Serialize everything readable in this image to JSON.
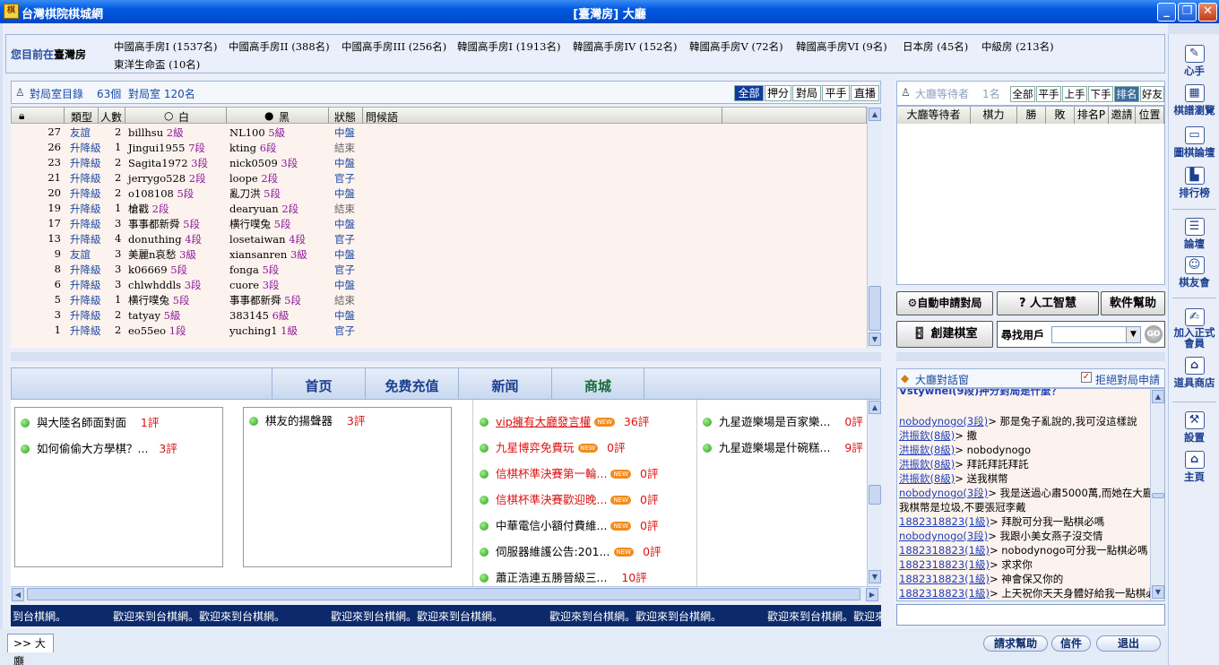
{
  "window": {
    "app_title": "台灣棋院棋城網",
    "center_title": "[臺灣房]  大廳"
  },
  "location": {
    "prefix": "您目前在",
    "room": "臺灣房"
  },
  "rooms": [
    "中國高手房I (1537名)",
    "中國高手房II (388名)",
    "中國高手房III (256名)",
    "韓國高手房I (1913名)",
    "韓國高手房IV (152名)",
    "韓國高手房V (72名)",
    "韓國高手房VI (9名)",
    "日本房 (45名)",
    "中級房 (213名)",
    "東洋生命盃 (10名)"
  ],
  "game_list": {
    "title": "對局室目錄",
    "count": "63個",
    "room_count": "對局室 120名",
    "filters": [
      "全部",
      "押分",
      "對局",
      "平手",
      "直播"
    ],
    "columns": [
      "",
      "類型",
      "人數",
      "白",
      "黑",
      "狀態",
      "問候語"
    ],
    "rows": [
      {
        "no": "27",
        "type": "友誼",
        "people": "2",
        "white": "billhsu",
        "wrank": "2級",
        "black": "NL100",
        "brank": "5級",
        "status": "中盤"
      },
      {
        "no": "26",
        "type": "升降級",
        "people": "1",
        "white": "Jingui1955",
        "wrank": "7段",
        "black": "kting",
        "brank": "6段",
        "status": "結束"
      },
      {
        "no": "23",
        "type": "升降級",
        "people": "2",
        "white": "Sagita1972",
        "wrank": "3段",
        "black": "nick0509",
        "brank": "3段",
        "status": "中盤"
      },
      {
        "no": "21",
        "type": "升降級",
        "people": "2",
        "white": "jerrygo528",
        "wrank": "2段",
        "black": "loope",
        "brank": "2段",
        "status": "官子"
      },
      {
        "no": "20",
        "type": "升降級",
        "people": "2",
        "white": "o108108",
        "wrank": "5段",
        "black": "亂刀洪",
        "brank": "5段",
        "status": "中盤"
      },
      {
        "no": "19",
        "type": "升降級",
        "people": "1",
        "white": "槍戳",
        "wrank": "2段",
        "black": "dearyuan",
        "brank": "2段",
        "status": "結束"
      },
      {
        "no": "17",
        "type": "升降級",
        "people": "3",
        "white": "事事都新舜",
        "wrank": "5段",
        "black": "横行噗兔",
        "brank": "5段",
        "status": "中盤"
      },
      {
        "no": "13",
        "type": "升降級",
        "people": "4",
        "white": "donuthing",
        "wrank": "4段",
        "black": "losetaiwan",
        "brank": "4段",
        "status": "官子"
      },
      {
        "no": "9",
        "type": "友誼",
        "people": "3",
        "white": "美麗n哀愁",
        "wrank": "3級",
        "black": "xiansanren",
        "brank": "3級",
        "status": "中盤"
      },
      {
        "no": "8",
        "type": "升降級",
        "people": "3",
        "white": "k06669",
        "wrank": "5段",
        "black": "fonga",
        "brank": "5段",
        "status": "官子"
      },
      {
        "no": "6",
        "type": "升降級",
        "people": "3",
        "white": "chlwhddls",
        "wrank": "3段",
        "black": "cuore",
        "brank": "3段",
        "status": "中盤"
      },
      {
        "no": "5",
        "type": "升降級",
        "people": "1",
        "white": "横行噗兔",
        "wrank": "5段",
        "black": "事事都新舜",
        "brank": "5段",
        "status": "結束"
      },
      {
        "no": "3",
        "type": "升降級",
        "people": "2",
        "white": "tatyay",
        "wrank": "5級",
        "black": "383145",
        "brank": "6級",
        "status": "中盤"
      },
      {
        "no": "1",
        "type": "升降級",
        "people": "2",
        "white": "eo55eo",
        "wrank": "1段",
        "black": "yuching1",
        "brank": "1級",
        "status": "官子"
      }
    ]
  },
  "nav": [
    "首页",
    "免费充值",
    "新闻",
    "商城"
  ],
  "news": {
    "col1": [
      {
        "text": "與大陸名師面對面",
        "count": "1評"
      },
      {
        "text": "如何偷偷大方學棋？...",
        "count": "3評"
      }
    ],
    "col2": [
      {
        "text": "棋友的揚聲器",
        "count": "3評"
      }
    ],
    "col3": [
      {
        "text": "vip擁有大廳發言權",
        "count": "36評"
      },
      {
        "text": "九星博弈免費玩",
        "count": "0評"
      },
      {
        "text": "信棋杯準決賽第一輪...",
        "count": "0評"
      },
      {
        "text": "信棋杯準決賽歡迎晚...",
        "count": "0評"
      },
      {
        "text": "中華電信小額付費維...",
        "count": "0評"
      },
      {
        "text": "伺服器維護公告:201...",
        "count": "0評"
      },
      {
        "text": "蕭正浩連五勝晉級三...",
        "count": "10評"
      }
    ],
    "col4": [
      {
        "text": "九星遊樂場是百家樂...",
        "count": "0評"
      },
      {
        "text": "九星遊樂場是什碗糕...",
        "count": "9評"
      }
    ],
    "new_tag": "NEW"
  },
  "marquee": [
    "到台棋網。",
    "歡迎來到台棋網。歡迎來到台棋網。",
    "歡迎來到台棋網。歡迎來到台棋網。",
    "歡迎來到台棋網。歡迎來到台棋網。",
    "歡迎來到台棋網。歡迎來到台棋"
  ],
  "waiting": {
    "title": "大廳等待者",
    "count": "1名",
    "filters": [
      "全部",
      "平手",
      "上手",
      "下手",
      "排名",
      "好友"
    ],
    "columns": [
      "大廳等待者",
      "棋力",
      "勝",
      "敗",
      "排名P",
      "邀請",
      "位置"
    ]
  },
  "actions": {
    "auto_apply": "自動申請對局",
    "ai": "人工智慧",
    "help": "軟件幫助",
    "create_room": "創建棋室",
    "find_user": "尋找用戶",
    "go": "GO"
  },
  "chat": {
    "title": "大廳對話窗",
    "refuse_label": "拒絕對局申請",
    "refuse_checked": true,
    "partial_top": "Vstywnei(9段)押分對局是什麼？",
    "lines": [
      {
        "user": "nobodynogo(3段)",
        "msg": "> 那是兔子亂說的,我可沒這樣說"
      },
      {
        "user": "洪振欽(8級)",
        "msg": "> 撒"
      },
      {
        "user": "洪振欽(8級)",
        "msg": "> nobodynogo"
      },
      {
        "user": "洪振欽(8級)",
        "msg": "> 拜託拜託拜託"
      },
      {
        "user": "洪振欽(8級)",
        "msg": "> 送我棋幣"
      },
      {
        "user": "nobodynogo(3段)",
        "msg": "> 我是送過心肅5000萬,而她在大廳嗆"
      },
      {
        "user": "",
        "msg": "我棋幣是垃圾,不要張冠李戴"
      },
      {
        "user": "1882318823(1級)",
        "msg": "> 拜脫可分我一點棋必嗎"
      },
      {
        "user": "nobodynogo(3段)",
        "msg": "> 我跟小美女燕子沒交情"
      },
      {
        "user": "1882318823(1級)",
        "msg": "> nobodynogo可分我一點棋必嗎"
      },
      {
        "user": "1882318823(1級)",
        "msg": "> 求求你"
      },
      {
        "user": "1882318823(1級)",
        "msg": "> 神會保又你的"
      },
      {
        "user": "1882318823(1級)",
        "msg": "> 上天祝你天天身體好給我一點棋必"
      }
    ]
  },
  "bottom": {
    "tab": ">> 大廳",
    "help": "請求幫助",
    "mail": "信件",
    "exit": "退出"
  },
  "sidebar": [
    "心手",
    "棋譜瀏覽",
    "圖棋論壇",
    "排行榜",
    "論壇",
    "棋友會",
    "加入正式會員",
    "道具商店",
    "設置",
    "主頁"
  ]
}
